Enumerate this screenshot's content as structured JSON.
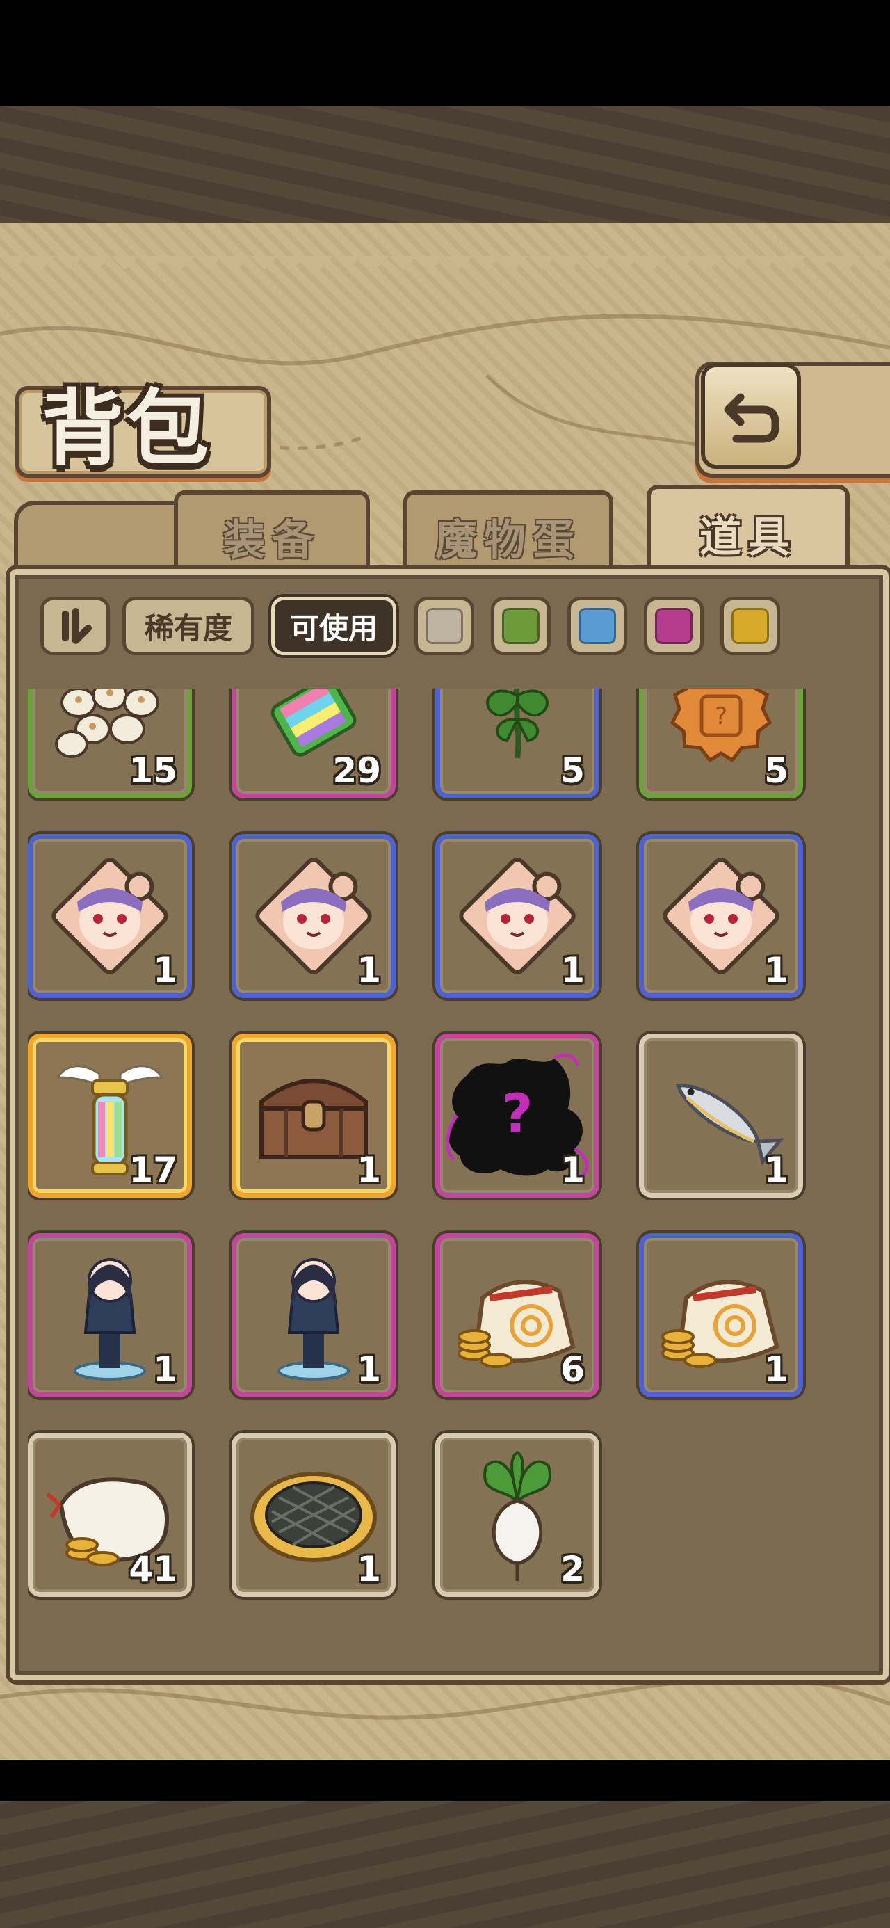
{
  "title": "背包",
  "tabs": [
    {
      "label": "装备",
      "active": false
    },
    {
      "label": "魔物蛋",
      "active": false
    },
    {
      "label": "道具",
      "active": true
    }
  ],
  "filters": {
    "rarity_label": "稀有度",
    "usable_label": "可使用",
    "swatches": [
      "#bdb39f",
      "#6f9a3b",
      "#5a9bd4",
      "#b43d8e",
      "#d6ab2a"
    ]
  },
  "items": [
    {
      "name": "eggs",
      "icon": "egg-pile-icon",
      "qty": "15",
      "rarity": "green"
    },
    {
      "name": "rainbow-ticket",
      "icon": "ticket-icon",
      "qty": "29",
      "rarity": "purple"
    },
    {
      "name": "herb",
      "icon": "herb-leaf-icon",
      "qty": "5",
      "rarity": "blue"
    },
    {
      "name": "mooncake",
      "icon": "mooncake-icon",
      "qty": "5",
      "rarity": "green"
    },
    {
      "name": "puzzle-piece-1",
      "icon": "puzzle-portrait-icon",
      "qty": "1",
      "rarity": "blue"
    },
    {
      "name": "puzzle-piece-2",
      "icon": "puzzle-portrait-icon",
      "qty": "1",
      "rarity": "blue"
    },
    {
      "name": "puzzle-piece-3",
      "icon": "puzzle-portrait-icon",
      "qty": "1",
      "rarity": "blue"
    },
    {
      "name": "puzzle-piece-4",
      "icon": "puzzle-portrait-icon",
      "qty": "1",
      "rarity": "blue"
    },
    {
      "name": "winged-lantern",
      "icon": "lantern-icon",
      "qty": "17",
      "rarity": "gold"
    },
    {
      "name": "treasure-chest",
      "icon": "chest-icon",
      "qty": "1",
      "rarity": "gold"
    },
    {
      "name": "mystery-silhouette",
      "icon": "mystery-icon",
      "qty": "1",
      "rarity": "purple"
    },
    {
      "name": "fish",
      "icon": "fish-icon",
      "qty": "1",
      "rarity": "gray"
    },
    {
      "name": "figure-witch",
      "icon": "figure-icon",
      "qty": "1",
      "rarity": "purple"
    },
    {
      "name": "figure-girl",
      "icon": "figure-icon",
      "qty": "1",
      "rarity": "purple"
    },
    {
      "name": "gold-coin-bag",
      "icon": "coin-bag-icon",
      "qty": "6",
      "rarity": "purple"
    },
    {
      "name": "coin-bag-small",
      "icon": "coin-bag-icon",
      "qty": "1",
      "rarity": "blue"
    },
    {
      "name": "money-sack",
      "icon": "sack-icon",
      "qty": "41",
      "rarity": "gray"
    },
    {
      "name": "pie",
      "icon": "pie-icon",
      "qty": "1",
      "rarity": "gray"
    },
    {
      "name": "turnip",
      "icon": "turnip-icon",
      "qty": "2",
      "rarity": "gray"
    }
  ]
}
